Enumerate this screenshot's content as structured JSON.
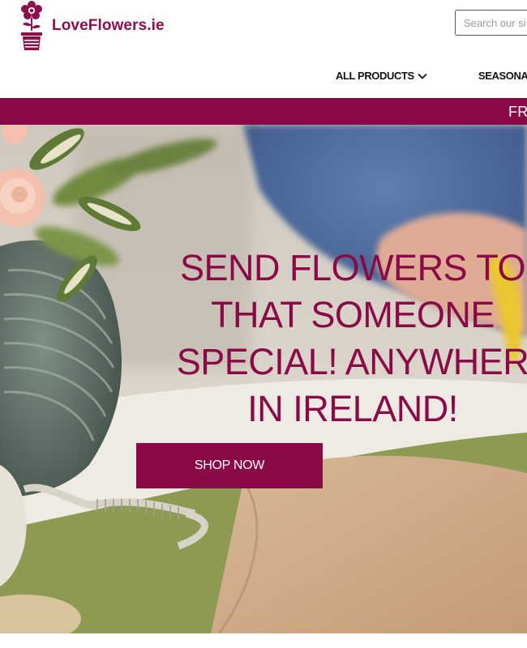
{
  "brand": {
    "name": "LoveFlowers.ie",
    "color": "#8a0f4a"
  },
  "search": {
    "placeholder": "Search our si"
  },
  "nav": {
    "items": [
      {
        "label": "ALL PRODUCTS",
        "has_dropdown": true
      },
      {
        "label": "SEASONA",
        "has_dropdown": false
      }
    ]
  },
  "promo": {
    "text": "FR",
    "background": "#8a0a48"
  },
  "hero": {
    "lines": [
      "SEND FLOWERS TO",
      "THAT SOMEONE",
      "SPECIAL! ANYWHER",
      "IN IRELAND!"
    ],
    "button_label": "SHOP NOW",
    "accent": "#8a0a48"
  },
  "icons": [
    "flower-pot-logo-icon",
    "chevron-down-icon"
  ]
}
